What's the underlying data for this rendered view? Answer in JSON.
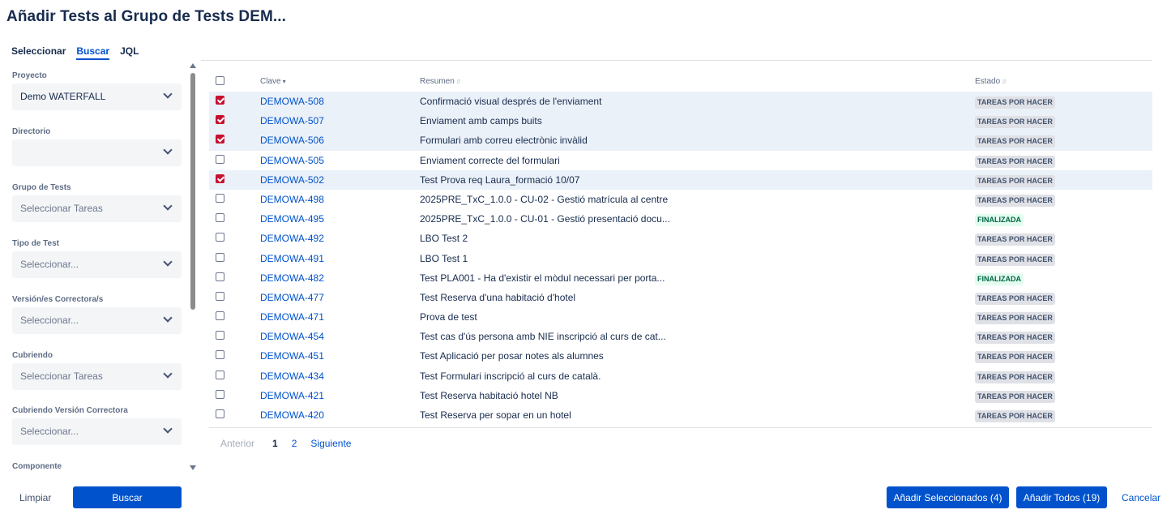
{
  "dialog": {
    "title": "Añadir Tests al Grupo de Tests DEM..."
  },
  "tabs": [
    {
      "label": "Seleccionar"
    },
    {
      "label": "Buscar"
    },
    {
      "label": "JQL"
    }
  ],
  "filters": [
    {
      "label": "Proyecto",
      "value": "Demo WATERFALL",
      "placeholder": false
    },
    {
      "label": "Directorio",
      "value": "",
      "placeholder": false
    },
    {
      "label": "Grupo de Tests",
      "value": "Seleccionar Tareas",
      "placeholder": true
    },
    {
      "label": "Tipo de Test",
      "value": "Seleccionar...",
      "placeholder": true
    },
    {
      "label": "Versión/es Correctora/s",
      "value": "Seleccionar...",
      "placeholder": true
    },
    {
      "label": "Cubriendo",
      "value": "Seleccionar Tareas",
      "placeholder": true
    },
    {
      "label": "Cubriendo Versión Correctora",
      "value": "Seleccionar...",
      "placeholder": true
    },
    {
      "label": "Componente",
      "value": "",
      "placeholder": false
    }
  ],
  "table": {
    "headers": {
      "key": "Clave",
      "summary": "Resumen",
      "status": "Estado"
    },
    "rows": [
      {
        "checked": true,
        "key": "DEMOWA-508",
        "summary": "Confirmació visual després de l'enviament",
        "status": "TAREAS POR HACER",
        "status_type": "todo"
      },
      {
        "checked": true,
        "key": "DEMOWA-507",
        "summary": "Enviament amb camps buits",
        "status": "TAREAS POR HACER",
        "status_type": "todo"
      },
      {
        "checked": true,
        "key": "DEMOWA-506",
        "summary": "Formulari amb correu electrònic invàlid",
        "status": "TAREAS POR HACER",
        "status_type": "todo"
      },
      {
        "checked": false,
        "key": "DEMOWA-505",
        "summary": "Enviament correcte del formulari",
        "status": "TAREAS POR HACER",
        "status_type": "todo"
      },
      {
        "checked": true,
        "key": "DEMOWA-502",
        "summary": "Test Prova req Laura_formació 10/07",
        "status": "TAREAS POR HACER",
        "status_type": "todo"
      },
      {
        "checked": false,
        "key": "DEMOWA-498",
        "summary": "2025PRE_TxC_1.0.0 - CU-02 - Gestió matrícula al centre",
        "status": "TAREAS POR HACER",
        "status_type": "todo"
      },
      {
        "checked": false,
        "key": "DEMOWA-495",
        "summary": "2025PRE_TxC_1.0.0 - CU-01 - Gestió presentació docu...",
        "status": "FINALIZADA",
        "status_type": "done"
      },
      {
        "checked": false,
        "key": "DEMOWA-492",
        "summary": "LBO Test 2",
        "status": "TAREAS POR HACER",
        "status_type": "todo"
      },
      {
        "checked": false,
        "key": "DEMOWA-491",
        "summary": "LBO Test 1",
        "status": "TAREAS POR HACER",
        "status_type": "todo"
      },
      {
        "checked": false,
        "key": "DEMOWA-482",
        "summary": "Test PLA001 - Ha d'existir el mòdul necessari per porta...",
        "status": "FINALIZADA",
        "status_type": "done"
      },
      {
        "checked": false,
        "key": "DEMOWA-477",
        "summary": "Test Reserva d'una habitació d'hotel",
        "status": "TAREAS POR HACER",
        "status_type": "todo"
      },
      {
        "checked": false,
        "key": "DEMOWA-471",
        "summary": "Prova de test",
        "status": "TAREAS POR HACER",
        "status_type": "todo"
      },
      {
        "checked": false,
        "key": "DEMOWA-454",
        "summary": "Test cas d'ús persona amb NIE inscripció al curs de cat...",
        "status": "TAREAS POR HACER",
        "status_type": "todo"
      },
      {
        "checked": false,
        "key": "DEMOWA-451",
        "summary": "Test Aplicació per posar notes als alumnes",
        "status": "TAREAS POR HACER",
        "status_type": "todo"
      },
      {
        "checked": false,
        "key": "DEMOWA-434",
        "summary": "Test Formulari inscripció al curs de català.",
        "status": "TAREAS POR HACER",
        "status_type": "todo"
      },
      {
        "checked": false,
        "key": "DEMOWA-421",
        "summary": "Test Reserva habitació hotel NB",
        "status": "TAREAS POR HACER",
        "status_type": "todo"
      },
      {
        "checked": false,
        "key": "DEMOWA-420",
        "summary": "Test Reserva per sopar en un hotel",
        "status": "TAREAS POR HACER",
        "status_type": "todo"
      }
    ]
  },
  "pagination": {
    "prev": "Anterior",
    "pages": [
      "1",
      "2"
    ],
    "current": "1",
    "next": "Siguiente"
  },
  "footer": {
    "clear_label": "Limpiar",
    "search_label": "Buscar",
    "add_selected_label": "Añadir Seleccionados (4)",
    "add_all_label": "Añadir Todos (19)",
    "cancel_label": "Cancelar"
  },
  "colors": {
    "accent": "#0052cc",
    "checkbox_checked": "#c8102e",
    "selected_row": "#ebf1f9"
  }
}
